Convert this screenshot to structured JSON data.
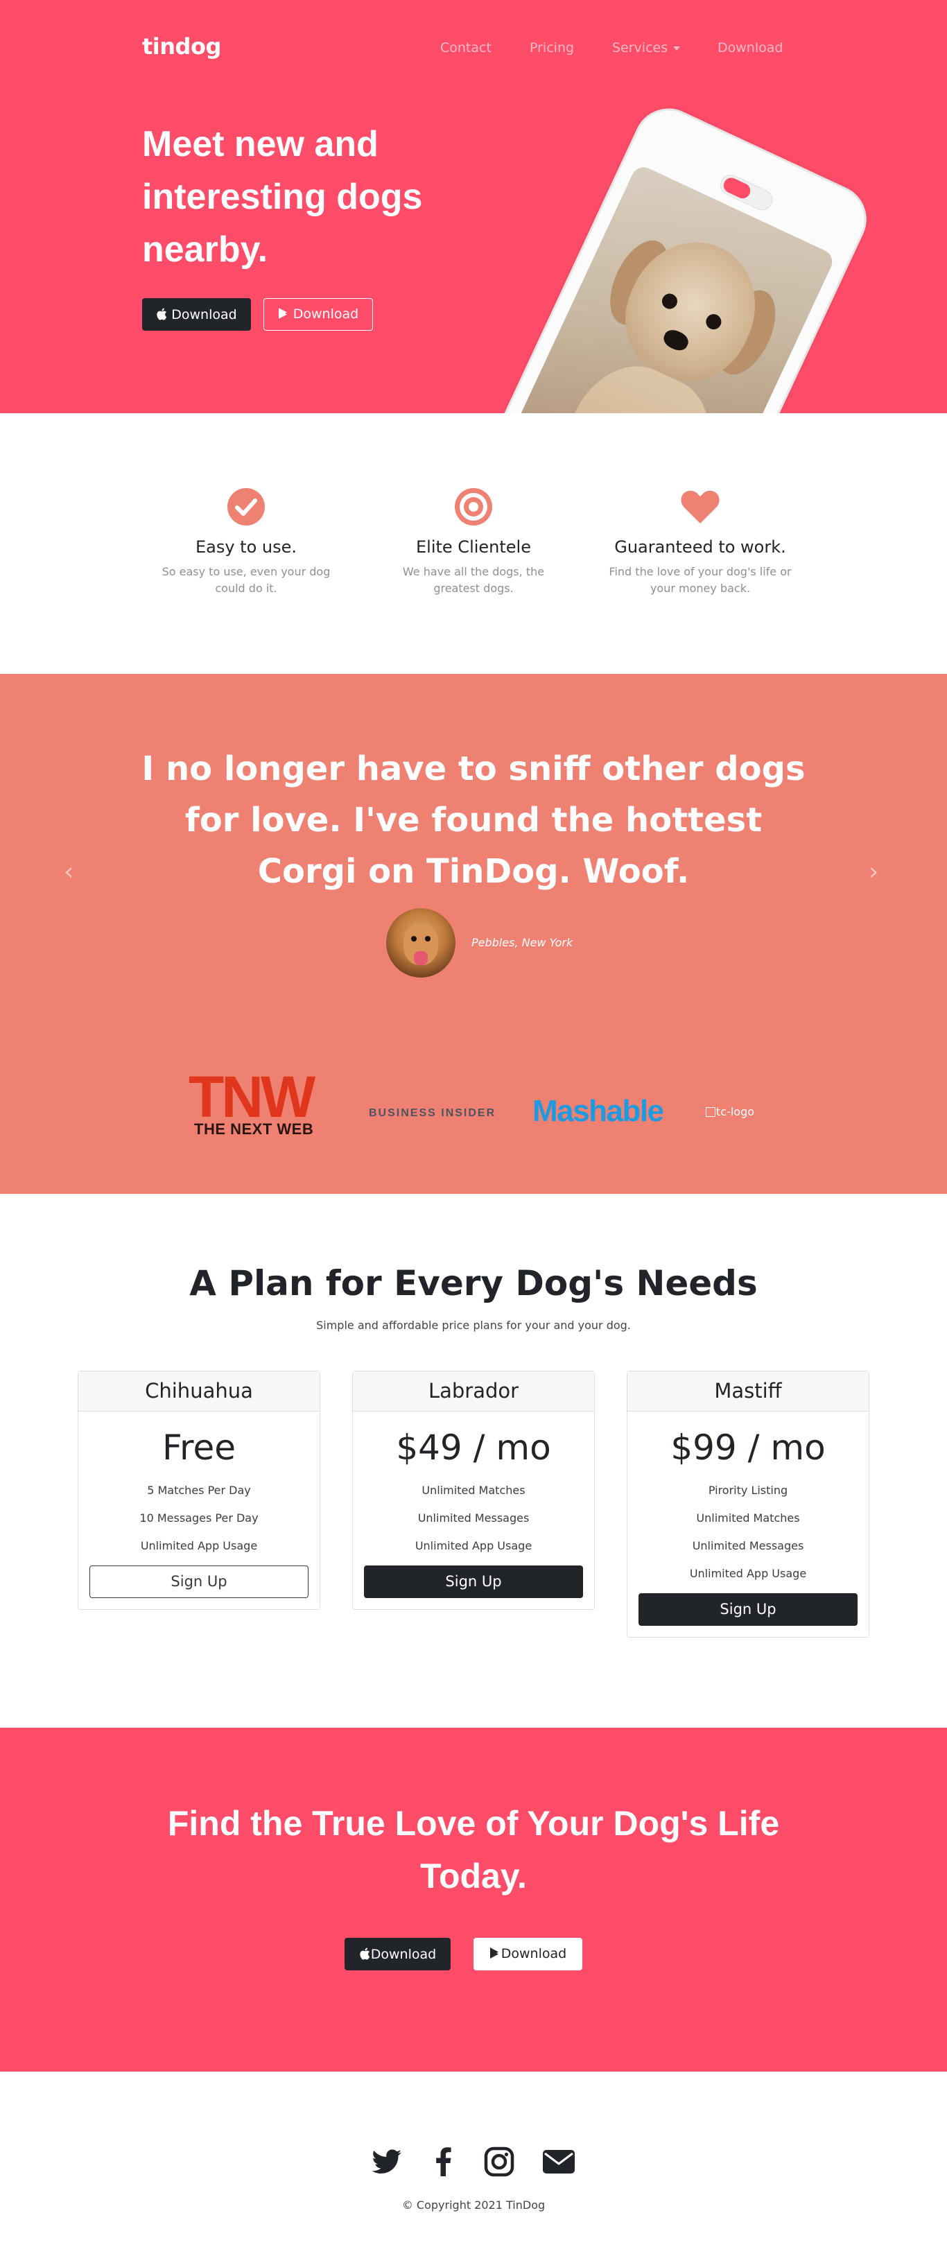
{
  "nav": {
    "brand": "tindog",
    "links": [
      "Contact",
      "Pricing",
      "Services",
      "Download"
    ]
  },
  "hero": {
    "heading": "Meet new and interesting dogs nearby.",
    "buttons": [
      {
        "label": "Download",
        "icon": "apple-icon"
      },
      {
        "label": "Download",
        "icon": "google-play-icon"
      }
    ]
  },
  "features": [
    {
      "icon": "check-circle-icon",
      "title": "Easy to use.",
      "text": "So easy to use, even your dog could do it."
    },
    {
      "icon": "bullseye-icon",
      "title": "Elite Clientele",
      "text": "We have all the dogs, the greatest dogs."
    },
    {
      "icon": "heart-icon",
      "title": "Guaranteed to work.",
      "text": "Find the love of your dog's life or your money back."
    }
  ],
  "testimonial": {
    "quote": "I no longer have to sniff other dogs for love. I've found the hottest Corgi on TinDog. Woof.",
    "author": "Pebbles, New York",
    "prev": "‹",
    "next": "›"
  },
  "press": {
    "tnw_mark": "TNW",
    "tnw_name": "THE NEXT WEB",
    "business_insider": "BUSINESS INSIDER",
    "mashable": "Mashable",
    "tc_alt": "tc-logo"
  },
  "pricing": {
    "title": "A Plan for Every Dog's Needs",
    "subtitle": "Simple and affordable price plans for your and your dog.",
    "plans": [
      {
        "name": "Chihuahua",
        "price": "Free",
        "features": [
          "5 Matches Per Day",
          "10 Messages Per Day",
          "Unlimited App Usage"
        ],
        "cta": "Sign Up",
        "style": "outline"
      },
      {
        "name": "Labrador",
        "price": "$49 / mo",
        "features": [
          "Unlimited Matches",
          "Unlimited Messages",
          "Unlimited App Usage"
        ],
        "cta": "Sign Up",
        "style": "dark"
      },
      {
        "name": "Mastiff",
        "price": "$99 / mo",
        "features": [
          "Pirority Listing",
          "Unlimited Matches",
          "Unlimited Messages",
          "Unlimited App Usage"
        ],
        "cta": "Sign Up",
        "style": "dark"
      }
    ]
  },
  "cta": {
    "heading": "Find the True Love of Your Dog's Life Today.",
    "buttons": [
      {
        "label": "Download",
        "icon": "apple-icon"
      },
      {
        "label": "Download",
        "icon": "google-play-icon"
      }
    ]
  },
  "footer": {
    "social": [
      "twitter-icon",
      "facebook-icon",
      "instagram-icon",
      "envelope-icon"
    ],
    "copyright": "© Copyright 2021 TinDog"
  },
  "colors": {
    "primary": "#ff4c68",
    "accent": "#ef8172",
    "dark": "#212529"
  }
}
